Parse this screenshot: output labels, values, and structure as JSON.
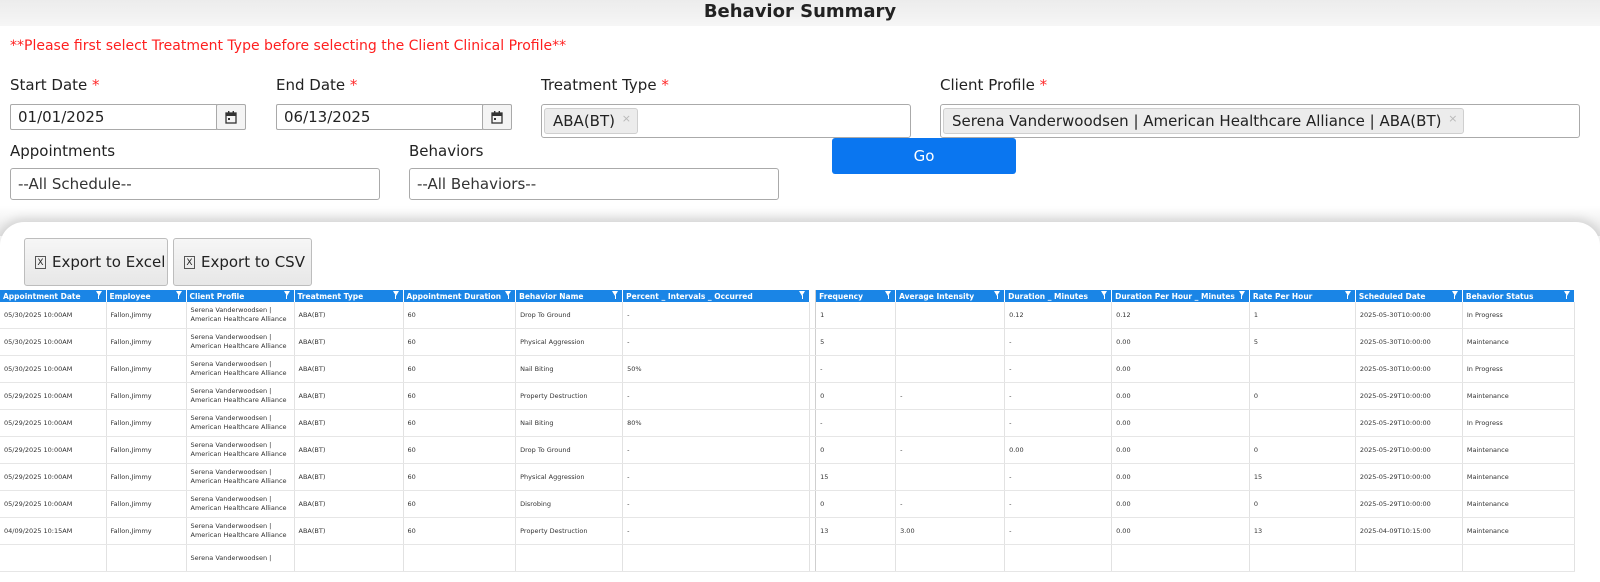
{
  "page": {
    "title": "Behavior Summary",
    "warning": "**Please first select Treatment Type before selecting the Client Clinical Profile**"
  },
  "filters": {
    "start_date_label": "Start Date",
    "start_date_value": "01/01/2025",
    "end_date_label": "End Date",
    "end_date_value": "06/13/2025",
    "treatment_type_label": "Treatment Type",
    "treatment_type_chip": "ABA(BT)",
    "client_profile_label": "Client Profile",
    "client_profile_chip": "Serena Vanderwoodsen | American Healthcare Alliance | ABA(BT)",
    "appointments_label": "Appointments",
    "appointments_value": "--All Schedule--",
    "behaviors_label": "Behaviors",
    "behaviors_value": "--All Behaviors--",
    "required_mark": "*",
    "chip_remove": "×",
    "go_label": "Go"
  },
  "toolbar": {
    "export_excel_label": "Export to Excel",
    "export_csv_label": "Export to CSV"
  },
  "icons": {
    "calendar": "calendar-icon",
    "excel": "excel-icon",
    "csv": "csv-icon",
    "filter": "filter-icon"
  },
  "colors": {
    "accent": "#0a76f0",
    "header": "#1a85e6",
    "warning": "#ff1f1f"
  },
  "grid": {
    "columns": [
      "Appointment Date",
      "Employee",
      "Client Profile",
      "Treatment Type",
      "Appointment Duration",
      "Behavior Name",
      "Percent _ Intervals _ Occurred",
      "Frequency",
      "Average Intensity",
      "Duration _ Minutes",
      "Duration Per Hour _ Minutes",
      "Rate Per Hour",
      "Scheduled Date",
      "Behavior Status"
    ],
    "rows": [
      [
        "05/30/2025 10:00AM",
        "Fallon,Jimmy",
        "Serena Vanderwoodsen | American Healthcare Alliance",
        "ABA(BT)",
        "60",
        "Drop To Ground",
        "-",
        "1",
        "",
        "0.12",
        "0.12",
        "1",
        "2025-05-30T10:00:00",
        "In Progress"
      ],
      [
        "05/30/2025 10:00AM",
        "Fallon,Jimmy",
        "Serena Vanderwoodsen | American Healthcare Alliance",
        "ABA(BT)",
        "60",
        "Physical Aggression",
        "-",
        "5",
        "",
        "-",
        "0.00",
        "5",
        "2025-05-30T10:00:00",
        "Maintenance"
      ],
      [
        "05/30/2025 10:00AM",
        "Fallon,Jimmy",
        "Serena Vanderwoodsen | American Healthcare Alliance",
        "ABA(BT)",
        "60",
        "Nail Biting",
        "50%",
        "-",
        "",
        "-",
        "0.00",
        "",
        "2025-05-30T10:00:00",
        "In Progress"
      ],
      [
        "05/29/2025 10:00AM",
        "Fallon,Jimmy",
        "Serena Vanderwoodsen | American Healthcare Alliance",
        "ABA(BT)",
        "60",
        "Property Destruction",
        "-",
        "0",
        "-",
        "-",
        "0.00",
        "0",
        "2025-05-29T10:00:00",
        "Maintenance"
      ],
      [
        "05/29/2025 10:00AM",
        "Fallon,Jimmy",
        "Serena Vanderwoodsen | American Healthcare Alliance",
        "ABA(BT)",
        "60",
        "Nail Biting",
        "80%",
        "-",
        "",
        "-",
        "0.00",
        "",
        "2025-05-29T10:00:00",
        "In Progress"
      ],
      [
        "05/29/2025 10:00AM",
        "Fallon,Jimmy",
        "Serena Vanderwoodsen | American Healthcare Alliance",
        "ABA(BT)",
        "60",
        "Drop To Ground",
        "-",
        "0",
        "-",
        "0.00",
        "0.00",
        "0",
        "2025-05-29T10:00:00",
        "Maintenance"
      ],
      [
        "05/29/2025 10:00AM",
        "Fallon,Jimmy",
        "Serena Vanderwoodsen | American Healthcare Alliance",
        "ABA(BT)",
        "60",
        "Physical Aggression",
        "-",
        "15",
        "",
        "-",
        "0.00",
        "15",
        "2025-05-29T10:00:00",
        "Maintenance"
      ],
      [
        "05/29/2025 10:00AM",
        "Fallon,Jimmy",
        "Serena Vanderwoodsen | American Healthcare Alliance",
        "ABA(BT)",
        "60",
        "Disrobing",
        "-",
        "0",
        "-",
        "-",
        "0.00",
        "0",
        "2025-05-29T10:00:00",
        "Maintenance"
      ],
      [
        "04/09/2025 10:15AM",
        "Fallon,Jimmy",
        "Serena Vanderwoodsen | American Healthcare Alliance",
        "ABA(BT)",
        "60",
        "Property Destruction",
        "-",
        "13",
        "3.00",
        "-",
        "0.00",
        "13",
        "2025-04-09T10:15:00",
        "Maintenance"
      ],
      [
        "",
        "",
        "Serena Vanderwoodsen |",
        "",
        "",
        "",
        "",
        "",
        "",
        "",
        "",
        "",
        "",
        ""
      ]
    ]
  }
}
